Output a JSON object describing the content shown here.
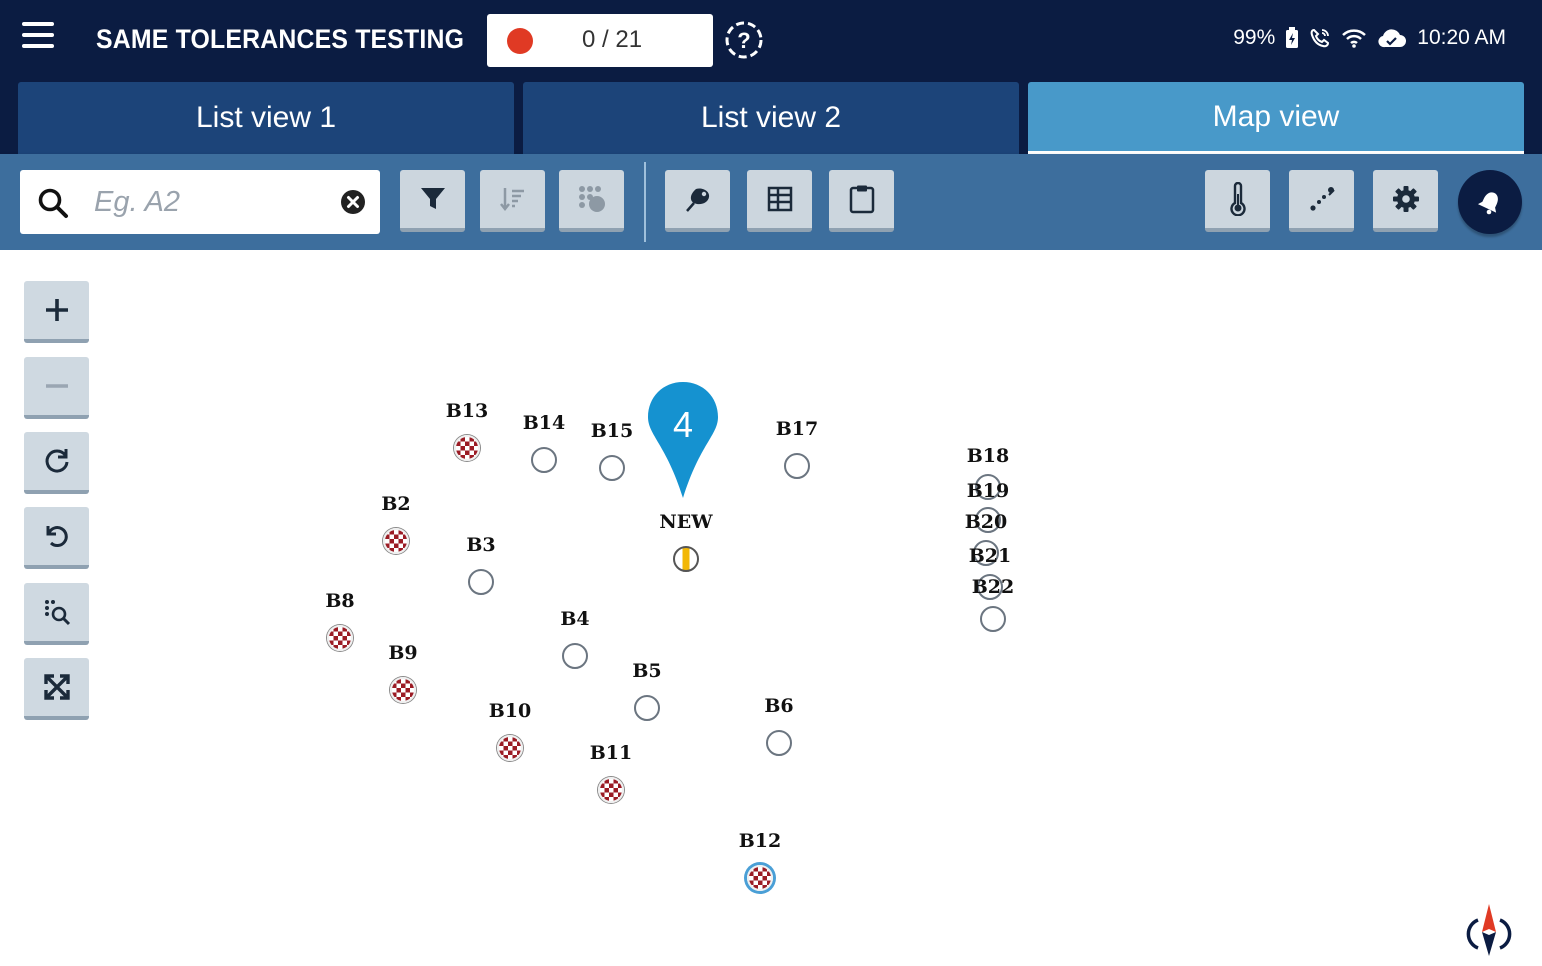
{
  "app": {
    "title": "SAME TOLERANCES TESTING",
    "counter": "0 / 21"
  },
  "status_bar": {
    "battery": "99%",
    "time": "10:20 AM"
  },
  "tabs": [
    {
      "label": "List view 1",
      "active": false
    },
    {
      "label": "List view 2",
      "active": false
    },
    {
      "label": "Map view",
      "active": true
    }
  ],
  "search": {
    "placeholder": "Eg. A2",
    "value": ""
  },
  "map": {
    "pin_number": "4",
    "points": [
      {
        "label": "B13",
        "state": "checked"
      },
      {
        "label": "B14",
        "state": "empty"
      },
      {
        "label": "B15",
        "state": "empty"
      },
      {
        "label": "B17",
        "state": "empty"
      },
      {
        "label": "B18",
        "state": "empty"
      },
      {
        "label": "B19",
        "state": "empty"
      },
      {
        "label": "B20",
        "state": "empty"
      },
      {
        "label": "B21",
        "state": "empty"
      },
      {
        "label": "B22",
        "state": "empty"
      },
      {
        "label": "B2",
        "state": "checked"
      },
      {
        "label": "B3",
        "state": "empty"
      },
      {
        "label": "NEW",
        "state": "new"
      },
      {
        "label": "B8",
        "state": "checked"
      },
      {
        "label": "B4",
        "state": "empty"
      },
      {
        "label": "B9",
        "state": "checked"
      },
      {
        "label": "B5",
        "state": "empty"
      },
      {
        "label": "B10",
        "state": "checked"
      },
      {
        "label": "B6",
        "state": "empty"
      },
      {
        "label": "B11",
        "state": "checked"
      },
      {
        "label": "B12",
        "state": "checked-selected"
      }
    ]
  },
  "colors": {
    "appbar": "#0b1c42",
    "tab": "#1c4479",
    "tab_active": "#4899c9",
    "toolbar": "#3d6e9d",
    "pin": "#1592d0",
    "checked_point": "#9b1b24",
    "new_point": "#f2b705"
  }
}
